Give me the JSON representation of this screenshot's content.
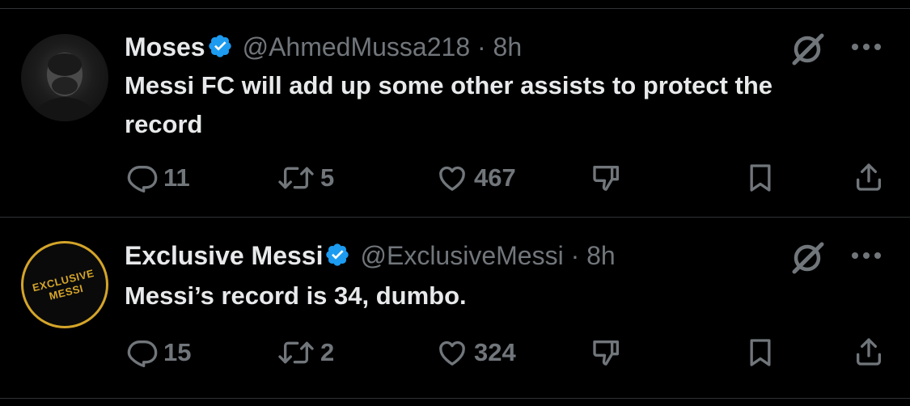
{
  "colors": {
    "background": "#000000",
    "text": "#e7e9ea",
    "muted": "#71767b",
    "divider": "#2f3336",
    "verified_badge": "#1d9bf0",
    "avatar_badge_gold": "#d4a52a"
  },
  "tweets": [
    {
      "name": "Moses",
      "verified": true,
      "handle": "@AhmedMussa218",
      "separator": "·",
      "time": "8h",
      "text": "Messi FC will add up some other assists to protect the record",
      "avatar": {
        "type": "photo"
      },
      "replies": "11",
      "reposts": "5",
      "likes": "467",
      "icons": [
        "grok-icon",
        "more-icon",
        "reply-icon",
        "repost-icon",
        "like-icon",
        "dislike-icon",
        "bookmark-icon",
        "share-icon"
      ]
    },
    {
      "name": "Exclusive Messi",
      "verified": true,
      "handle": "@ExclusiveMessi",
      "separator": "·",
      "time": "8h",
      "text": "Messi’s record is 34, dumbo.",
      "avatar": {
        "type": "badge",
        "line1": "EXCLUSIVE",
        "line2": "MESSI"
      },
      "replies": "15",
      "reposts": "2",
      "likes": "324",
      "icons": [
        "grok-icon",
        "more-icon",
        "reply-icon",
        "repost-icon",
        "like-icon",
        "dislike-icon",
        "bookmark-icon",
        "share-icon"
      ]
    }
  ]
}
